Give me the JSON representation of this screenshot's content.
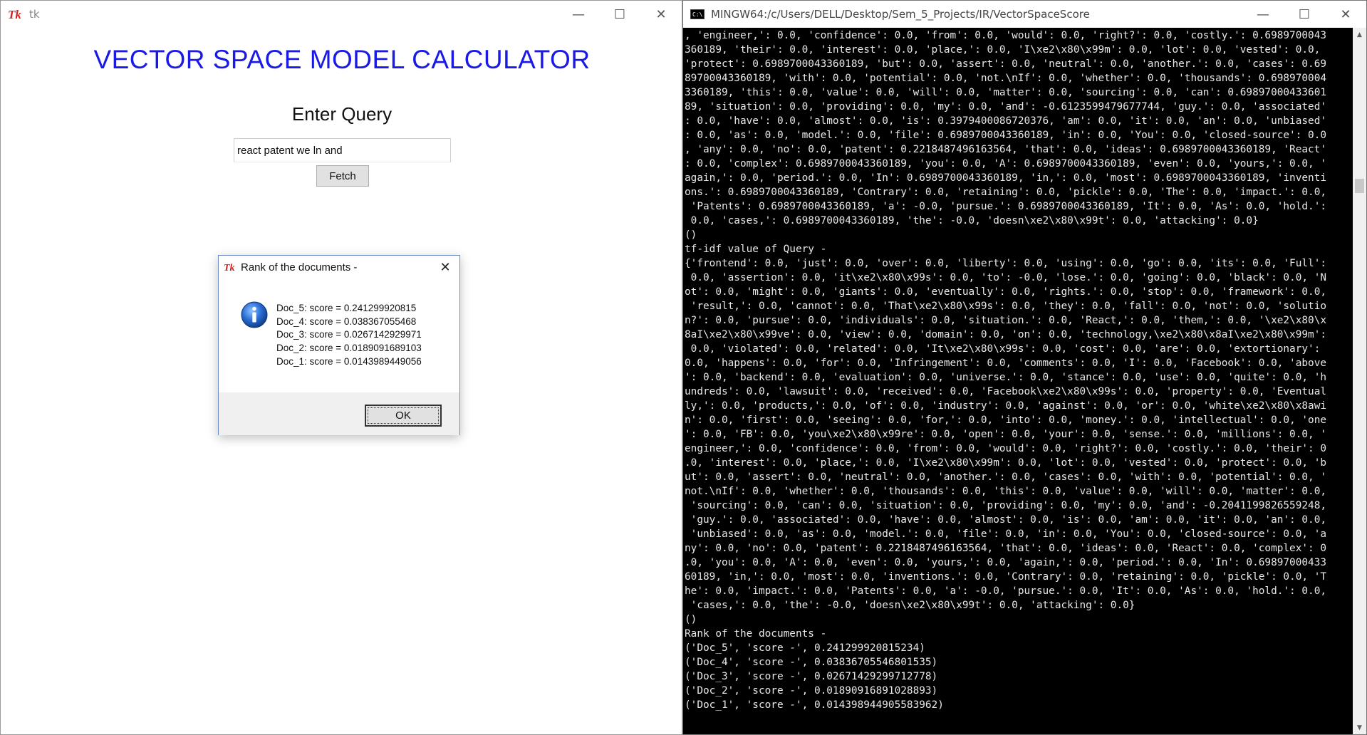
{
  "tk_window": {
    "title": "tk",
    "heading": "VECTOR SPACE MODEL CALCULATOR",
    "subheading": "Enter Query",
    "query_value": "react patent we ln and",
    "fetch_label": "Fetch",
    "controls": {
      "minimize": "—",
      "maximize": "☐",
      "close": "✕"
    }
  },
  "dialog": {
    "title": "Rank of the documents -",
    "close": "✕",
    "lines": [
      "Doc_5: score = 0.241299920815",
      "Doc_4: score = 0.038367055468",
      "Doc_3: score = 0.0267142929971",
      "Doc_2: score = 0.0189091689103",
      "Doc_1: score = 0.0143989449056"
    ],
    "ok_label": "OK"
  },
  "console": {
    "title": "MINGW64:/c/Users/DELL/Desktop/Sem_5_Projects/IR/VectorSpaceScore",
    "controls": {
      "minimize": "—",
      "maximize": "☐",
      "close": "✕"
    },
    "lines": [
      ", 'engineer,': 0.0, 'confidence': 0.0, 'from': 0.0, 'would': 0.0, 'right?': 0.0, 'costly.': 0.6989700043",
      "360189, 'their': 0.0, 'interest': 0.0, 'place,': 0.0, 'I\\xe2\\x80\\x99m': 0.0, 'lot': 0.0, 'vested': 0.0,",
      "'protect': 0.6989700043360189, 'but': 0.0, 'assert': 0.0, 'neutral': 0.0, 'another.': 0.0, 'cases': 0.69",
      "89700043360189, 'with': 0.0, 'potential': 0.0, 'not.\\nIf': 0.0, 'whether': 0.0, 'thousands': 0.698970004",
      "3360189, 'this': 0.0, 'value': 0.0, 'will': 0.0, 'matter': 0.0, 'sourcing': 0.0, 'can': 0.69897000433601",
      "89, 'situation': 0.0, 'providing': 0.0, 'my': 0.0, 'and': -0.6123599479677744, 'guy.': 0.0, 'associated'",
      ": 0.0, 'have': 0.0, 'almost': 0.0, 'is': 0.3979400086720376, 'am': 0.0, 'it': 0.0, 'an': 0.0, 'unbiased'",
      ": 0.0, 'as': 0.0, 'model.': 0.0, 'file': 0.6989700043360189, 'in': 0.0, 'You': 0.0, 'closed-source': 0.0",
      ", 'any': 0.0, 'no': 0.0, 'patent': 0.2218487496163564, 'that': 0.0, 'ideas': 0.6989700043360189, 'React'",
      ": 0.0, 'complex': 0.6989700043360189, 'you': 0.0, 'A': 0.6989700043360189, 'even': 0.0, 'yours,': 0.0, '",
      "again,': 0.0, 'period.': 0.0, 'In': 0.6989700043360189, 'in,': 0.0, 'most': 0.6989700043360189, 'inventi",
      "ons.': 0.6989700043360189, 'Contrary': 0.0, 'retaining': 0.0, 'pickle': 0.0, 'The': 0.0, 'impact.': 0.0,",
      " 'Patents': 0.6989700043360189, 'a': -0.0, 'pursue.': 0.6989700043360189, 'It': 0.0, 'As': 0.0, 'hold.':",
      " 0.0, 'cases,': 0.6989700043360189, 'the': -0.0, 'doesn\\xe2\\x80\\x99t': 0.0, 'attacking': 0.0}",
      "()",
      "tf-idf value of Query -",
      "{'frontend': 0.0, 'just': 0.0, 'over': 0.0, 'liberty': 0.0, 'using': 0.0, 'go': 0.0, 'its': 0.0, 'Full':",
      " 0.0, 'assertion': 0.0, 'it\\xe2\\x80\\x99s': 0.0, 'to': -0.0, 'lose.': 0.0, 'going': 0.0, 'black': 0.0, 'N",
      "ot': 0.0, 'might': 0.0, 'giants': 0.0, 'eventually': 0.0, 'rights.': 0.0, 'stop': 0.0, 'framework': 0.0,",
      " 'result,': 0.0, 'cannot': 0.0, 'That\\xe2\\x80\\x99s': 0.0, 'they': 0.0, 'fall': 0.0, 'not': 0.0, 'solutio",
      "n?': 0.0, 'pursue': 0.0, 'individuals': 0.0, 'situation.': 0.0, 'React,': 0.0, 'them,': 0.0, '\\xe2\\x80\\x",
      "8aI\\xe2\\x80\\x99ve': 0.0, 'view': 0.0, 'domain': 0.0, 'on': 0.0, 'technology,\\xe2\\x80\\x8aI\\xe2\\x80\\x99m':",
      " 0.0, 'violated': 0.0, 'related': 0.0, 'It\\xe2\\x80\\x99s': 0.0, 'cost': 0.0, 'are': 0.0, 'extortionary':",
      "0.0, 'happens': 0.0, 'for': 0.0, 'Infringement': 0.0, 'comments': 0.0, 'I': 0.0, 'Facebook': 0.0, 'above",
      "': 0.0, 'backend': 0.0, 'evaluation': 0.0, 'universe.': 0.0, 'stance': 0.0, 'use': 0.0, 'quite': 0.0, 'h",
      "undreds': 0.0, 'lawsuit': 0.0, 'received': 0.0, 'Facebook\\xe2\\x80\\x99s': 0.0, 'property': 0.0, 'Eventual",
      "ly,': 0.0, 'products,': 0.0, 'of': 0.0, 'industry': 0.0, 'against': 0.0, 'or': 0.0, 'white\\xe2\\x80\\x8awi",
      "n': 0.0, 'first': 0.0, 'seeing': 0.0, 'for,': 0.0, 'into': 0.0, 'money.': 0.0, 'intellectual': 0.0, 'one",
      "': 0.0, 'FB': 0.0, 'you\\xe2\\x80\\x99re': 0.0, 'open': 0.0, 'your': 0.0, 'sense.': 0.0, 'millions': 0.0, '",
      "engineer,': 0.0, 'confidence': 0.0, 'from': 0.0, 'would': 0.0, 'right?': 0.0, 'costly.': 0.0, 'their': 0",
      ".0, 'interest': 0.0, 'place,': 0.0, 'I\\xe2\\x80\\x99m': 0.0, 'lot': 0.0, 'vested': 0.0, 'protect': 0.0, 'b",
      "ut': 0.0, 'assert': 0.0, 'neutral': 0.0, 'another.': 0.0, 'cases': 0.0, 'with': 0.0, 'potential': 0.0, '",
      "not.\\nIf': 0.0, 'whether': 0.0, 'thousands': 0.0, 'this': 0.0, 'value': 0.0, 'will': 0.0, 'matter': 0.0,",
      " 'sourcing': 0.0, 'can': 0.0, 'situation': 0.0, 'providing': 0.0, 'my': 0.0, 'and': -0.2041199826559248,",
      " 'guy.': 0.0, 'associated': 0.0, 'have': 0.0, 'almost': 0.0, 'is': 0.0, 'am': 0.0, 'it': 0.0, 'an': 0.0,",
      " 'unbiased': 0.0, 'as': 0.0, 'model.': 0.0, 'file': 0.0, 'in': 0.0, 'You': 0.0, 'closed-source': 0.0, 'a",
      "ny': 0.0, 'no': 0.0, 'patent': 0.2218487496163564, 'that': 0.0, 'ideas': 0.0, 'React': 0.0, 'complex': 0",
      ".0, 'you': 0.0, 'A': 0.0, 'even': 0.0, 'yours,': 0.0, 'again,': 0.0, 'period.': 0.0, 'In': 0.69897000433",
      "60189, 'in,': 0.0, 'most': 0.0, 'inventions.': 0.0, 'Contrary': 0.0, 'retaining': 0.0, 'pickle': 0.0, 'T",
      "he': 0.0, 'impact.': 0.0, 'Patents': 0.0, 'a': -0.0, 'pursue.': 0.0, 'It': 0.0, 'As': 0.0, 'hold.': 0.0,",
      " 'cases,': 0.0, 'the': -0.0, 'doesn\\xe2\\x80\\x99t': 0.0, 'attacking': 0.0}",
      "()",
      "Rank of the documents -",
      "('Doc_5', 'score -', 0.241299920815234)",
      "('Doc_4', 'score -', 0.03836705546801535)",
      "('Doc_3', 'score -', 0.02671429299712778)",
      "('Doc_2', 'score -', 0.01890916891028893)",
      "('Doc_1', 'score -', 0.014398944905583962)"
    ]
  },
  "icons": {
    "tk_logo": "tk-feather-logo",
    "info": "info-icon",
    "console": "console-icon"
  },
  "colors": {
    "heading": "#1a1ae6",
    "console_bg": "#000000",
    "console_fg": "#e8e8e8",
    "dialog_border": "#6b8ec9"
  }
}
